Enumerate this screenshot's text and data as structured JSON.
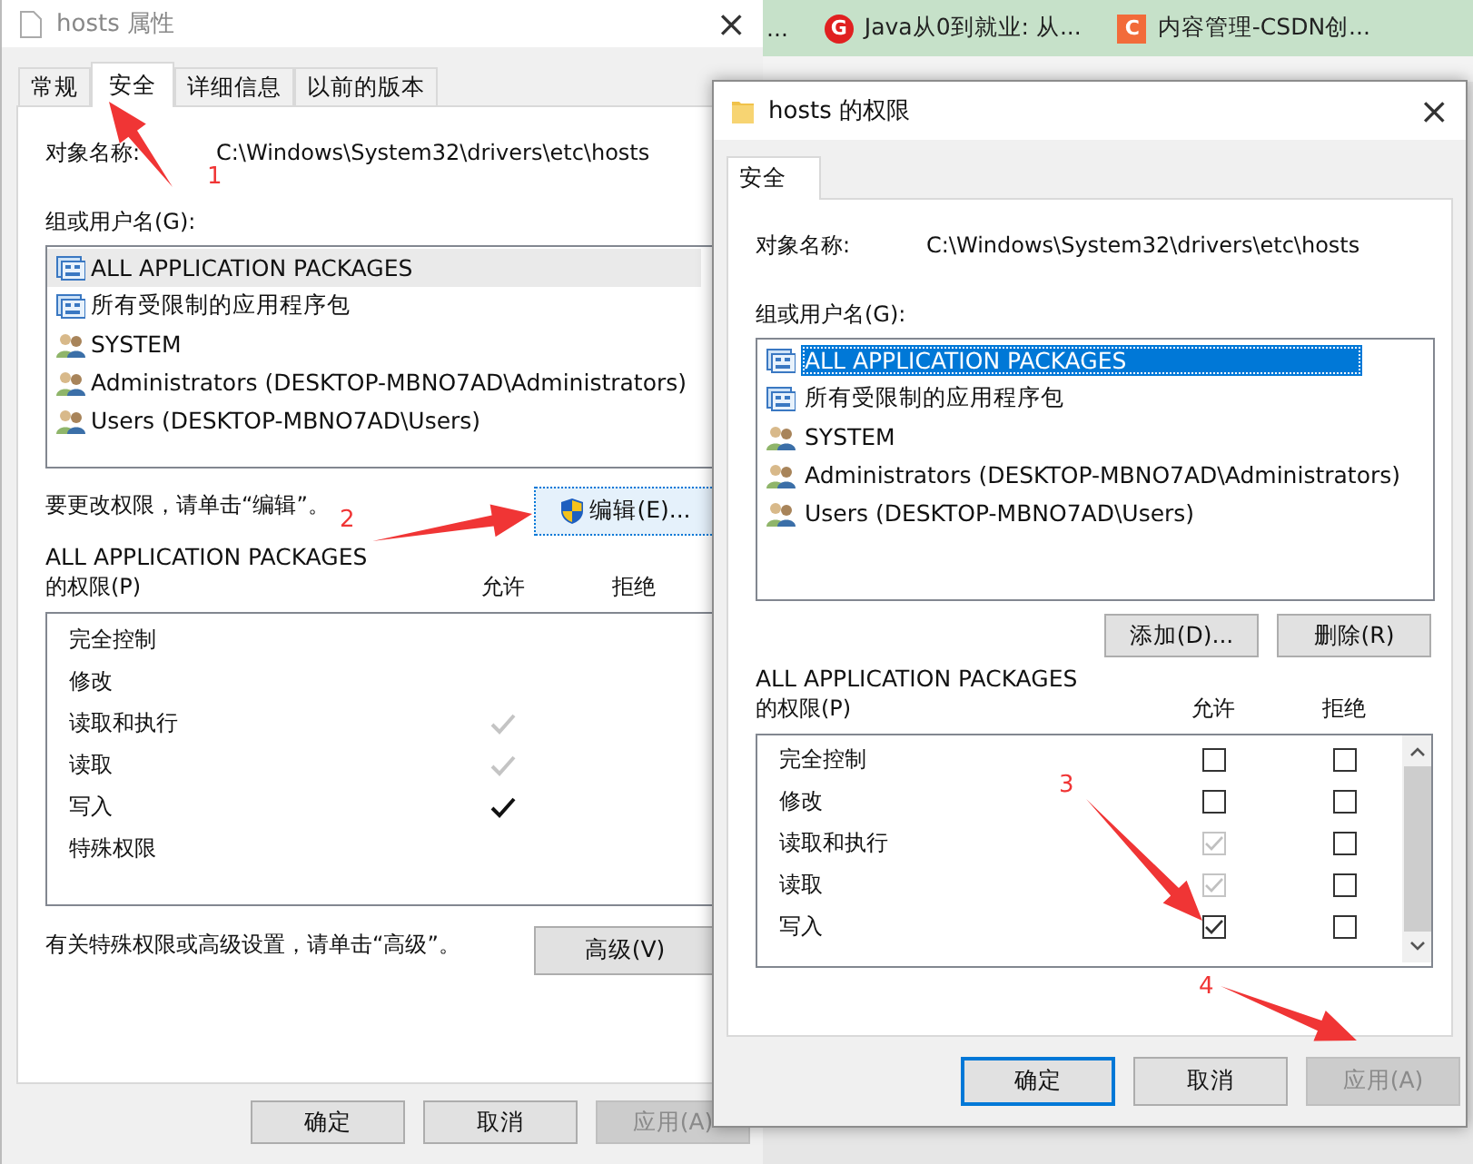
{
  "browser_tabs": [
    {
      "title": "..."
    },
    {
      "icon": "G",
      "kind": "circle",
      "title": "Java从0到就业: 从..."
    },
    {
      "icon": "C",
      "kind": "square",
      "title": "内容管理-CSDN创..."
    }
  ],
  "properties_dialog": {
    "title": "hosts 属性",
    "close": "×",
    "tabs": [
      {
        "label": "常规",
        "selected": false
      },
      {
        "label": "安全",
        "selected": true
      },
      {
        "label": "详细信息",
        "selected": false
      },
      {
        "label": "以前的版本",
        "selected": false
      }
    ],
    "object_label": "对象名称:",
    "object_path": "C:\\Windows\\System32\\drivers\\etc\\hosts",
    "groups_label": "组或用户名(G):",
    "groups": [
      {
        "name": "ALL APPLICATION PACKAGES",
        "kind": "package",
        "selected": true
      },
      {
        "name": "所有受限制的应用程序包",
        "kind": "package",
        "selected": false
      },
      {
        "name": "SYSTEM",
        "kind": "users",
        "selected": false
      },
      {
        "name": "Administrators (DESKTOP-MBNO7AD\\Administrators)",
        "kind": "users",
        "selected": false
      },
      {
        "name": "Users (DESKTOP-MBNO7AD\\Users)",
        "kind": "users",
        "selected": false
      }
    ],
    "edit_hint": "要更改权限，请单击“编辑”。",
    "edit_button": "编辑(E)...",
    "perm_title": "ALL APPLICATION PACKAGES",
    "perm_label": "的权限(P)",
    "allow_header": "允许",
    "deny_header": "拒绝",
    "permissions": [
      {
        "name": "完全控制",
        "allow": false,
        "deny": false
      },
      {
        "name": "修改",
        "allow": false,
        "deny": false
      },
      {
        "name": "读取和执行",
        "allow": true,
        "inherited": true,
        "deny": false
      },
      {
        "name": "读取",
        "allow": true,
        "inherited": true,
        "deny": false
      },
      {
        "name": "写入",
        "allow": true,
        "inherited": false,
        "deny": false
      },
      {
        "name": "特殊权限",
        "allow": false,
        "deny": false
      }
    ],
    "advanced_hint": "有关特殊权限或高级设置，请单击“高级”。",
    "advanced_button": "高级(V)",
    "buttons": [
      {
        "label": "确定",
        "disabled": false
      },
      {
        "label": "取消",
        "disabled": false
      },
      {
        "label": "应用(A)",
        "disabled": true
      }
    ]
  },
  "permissions_dialog": {
    "title": "hosts 的权限",
    "close": "×",
    "tabs": [
      {
        "label": "安全",
        "selected": true
      }
    ],
    "object_label": "对象名称:",
    "object_path": "C:\\Windows\\System32\\drivers\\etc\\hosts",
    "groups_label": "组或用户名(G):",
    "groups": [
      {
        "name": "ALL APPLICATION PACKAGES",
        "kind": "package",
        "selected": true
      },
      {
        "name": "所有受限制的应用程序包",
        "kind": "package",
        "selected": false
      },
      {
        "name": "SYSTEM",
        "kind": "users",
        "selected": false
      },
      {
        "name": "Administrators (DESKTOP-MBNO7AD\\Administrators)",
        "kind": "users",
        "selected": false
      },
      {
        "name": "Users (DESKTOP-MBNO7AD\\Users)",
        "kind": "users",
        "selected": false
      }
    ],
    "list_buttons": [
      "添加(D)...",
      "删除(R)"
    ],
    "perm_title": "ALL APPLICATION PACKAGES",
    "perm_label": "的权限(P)",
    "allow_header": "允许",
    "deny_header": "拒绝",
    "permissions": [
      {
        "name": "完全控制",
        "allow": false,
        "disabled": false,
        "deny": false
      },
      {
        "name": "修改",
        "allow": false,
        "disabled": false,
        "deny": false
      },
      {
        "name": "读取和执行",
        "allow": true,
        "disabled": true,
        "deny": false
      },
      {
        "name": "读取",
        "allow": true,
        "disabled": true,
        "deny": false
      },
      {
        "name": "写入",
        "allow": true,
        "disabled": false,
        "deny": false
      }
    ],
    "buttons": [
      {
        "label": "确定",
        "disabled": false,
        "default": true
      },
      {
        "label": "取消",
        "disabled": false,
        "default": false
      },
      {
        "label": "应用(A)",
        "disabled": true,
        "default": false
      }
    ]
  },
  "annotations": [
    "1",
    "2",
    "3",
    "4"
  ]
}
